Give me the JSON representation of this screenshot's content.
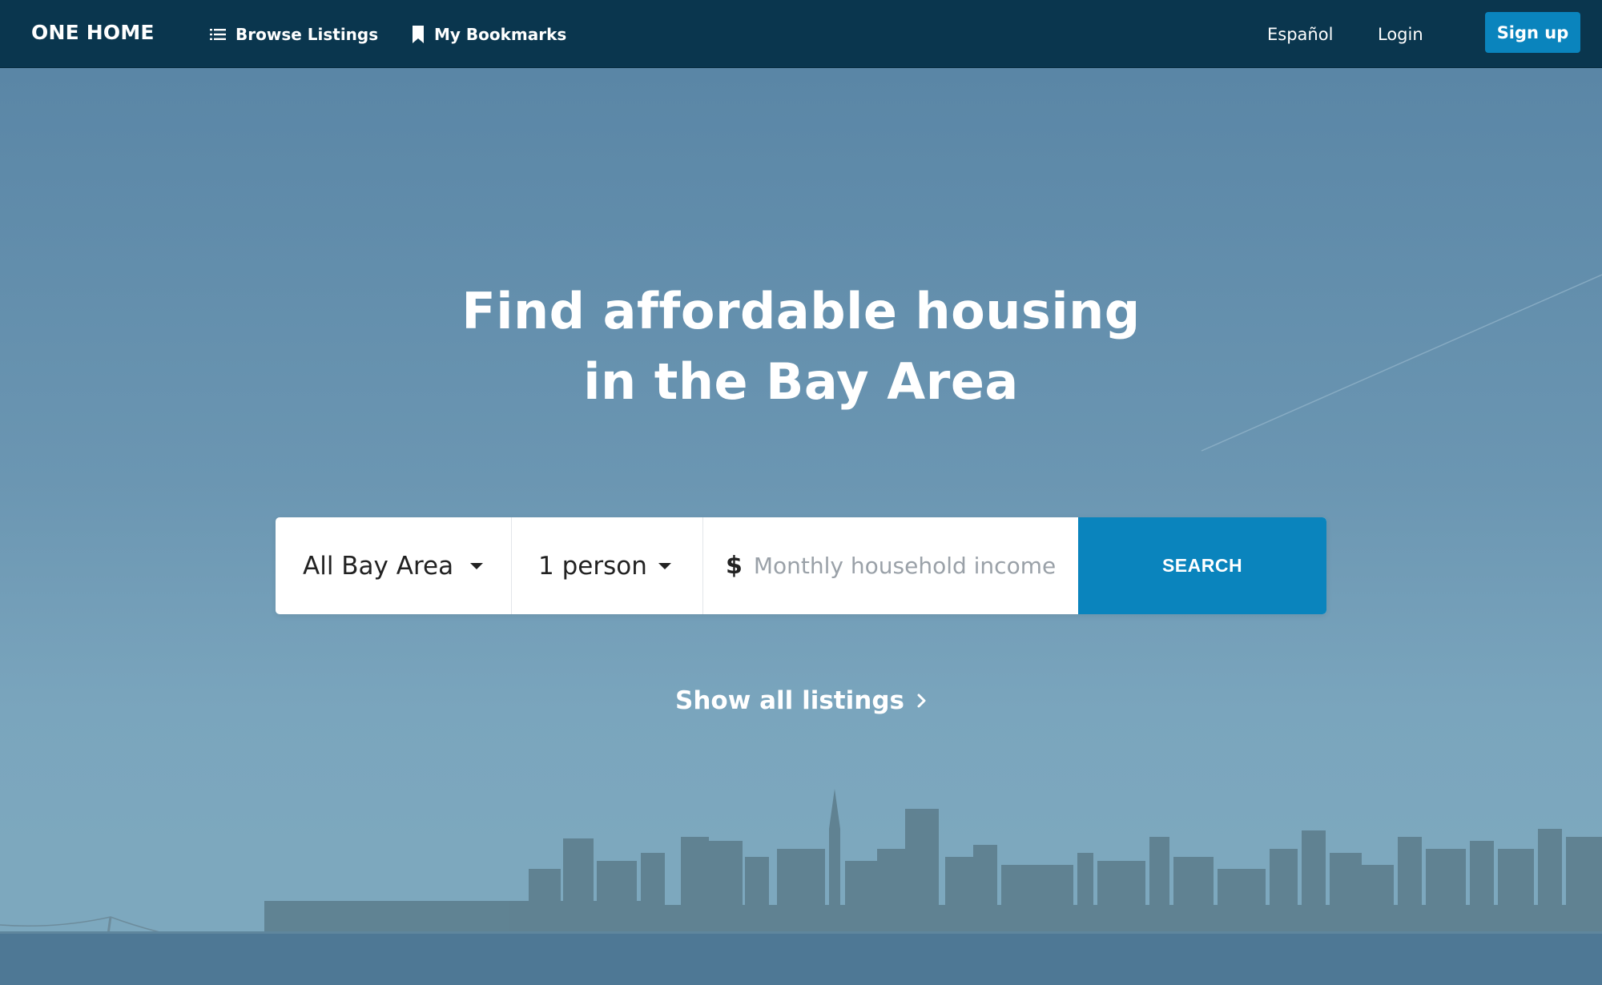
{
  "navbar": {
    "brand": "ONE HOME",
    "browse_label": "Browse Listings",
    "bookmarks_label": "My Bookmarks",
    "language_label": "Español",
    "login_label": "Login",
    "signup_label": "Sign up"
  },
  "hero": {
    "headline_line1": "Find affordable housing",
    "headline_line2": "in the Bay Area",
    "search": {
      "region_value": "All Bay Area",
      "household_value": "1 person",
      "currency_symbol": "$",
      "income_placeholder": "Monthly household income",
      "search_label": "SEARCH"
    },
    "show_all_label": "Show all listings"
  },
  "colors": {
    "navbar_bg": "#0a364e",
    "accent": "#0a84bd",
    "sky": "#5f8aa8"
  },
  "icons": {
    "browse": "list-icon",
    "bookmarks": "bookmark-icon",
    "region_caret": "caret-down-icon",
    "household_caret": "caret-down-icon",
    "show_all": "chevron-right-icon"
  }
}
